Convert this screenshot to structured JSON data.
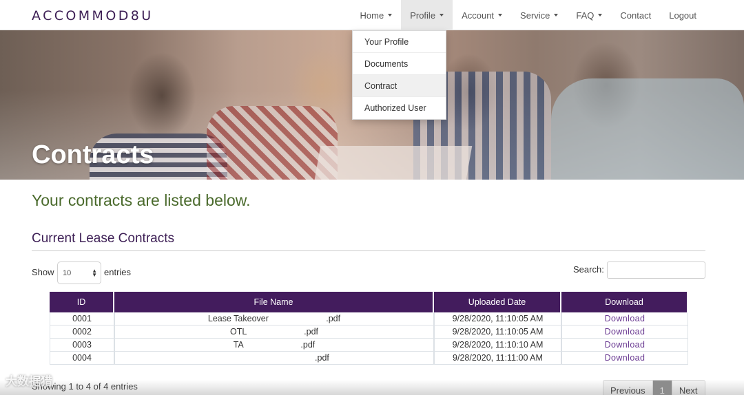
{
  "brand": "ACCOMMOD8U",
  "nav": [
    {
      "label": "Home",
      "caret": true,
      "active": false
    },
    {
      "label": "Profile",
      "caret": true,
      "active": true
    },
    {
      "label": "Account",
      "caret": true,
      "active": false
    },
    {
      "label": "Service",
      "caret": true,
      "active": false
    },
    {
      "label": "FAQ",
      "caret": true,
      "active": false
    },
    {
      "label": "Contact",
      "caret": false,
      "active": false
    },
    {
      "label": "Logout",
      "caret": false,
      "active": false
    }
  ],
  "profile_menu": [
    "Your Profile",
    "Documents",
    "Contract",
    "Authorized User"
  ],
  "hero": {
    "title": "Contracts"
  },
  "intro": "Your contracts are listed below.",
  "section_title": "Current Lease Contracts",
  "controls": {
    "show_label": "Show",
    "entries_value": "10",
    "entries_label": "entries",
    "search_label": "Search:",
    "search_value": ""
  },
  "table": {
    "headers": [
      "ID",
      "File Name",
      "Uploaded Date",
      "Download"
    ],
    "rows": [
      {
        "id": "0001",
        "file": "Lease Takeover                        .pdf",
        "date": "9/28/2020, 11:10:05 AM",
        "action": "Download"
      },
      {
        "id": "0002",
        "file": "OTL                        .pdf",
        "date": "9/28/2020, 11:10:05 AM",
        "action": "Download"
      },
      {
        "id": "0003",
        "file": "TA                        .pdf",
        "date": "9/28/2020, 11:10:10 AM",
        "action": "Download"
      },
      {
        "id": "0004",
        "file": "                                        .pdf",
        "date": "9/28/2020, 11:11:00 AM",
        "action": "Download"
      }
    ]
  },
  "info": "Showing 1 to 4 of 4 entries",
  "pagination": {
    "previous": "Previous",
    "current": "1",
    "next": "Next"
  },
  "watermark": "大数据猎",
  "colors": {
    "brand": "#3d1f55",
    "header_bg": "#431c5d",
    "intro": "#4a6a2c",
    "link": "#6a3a92"
  }
}
